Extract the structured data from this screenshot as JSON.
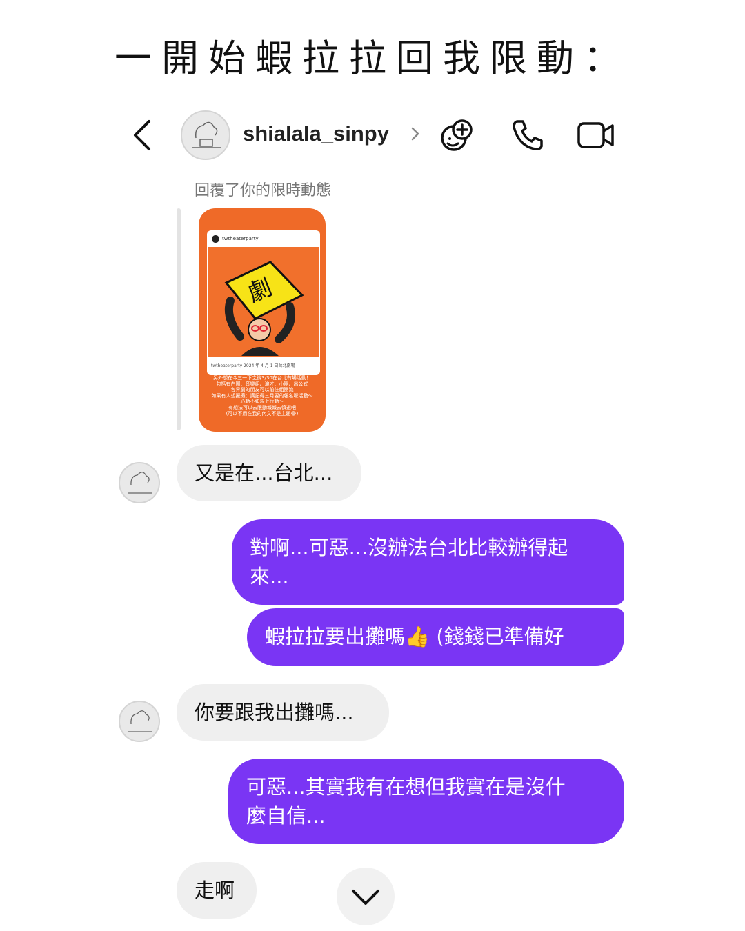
{
  "title": "一開始蝦拉拉回我限動：",
  "header": {
    "username": "shialala_sinpy",
    "icons": {
      "back": "chevron-left-icon",
      "chevron": "chevron-right-icon",
      "effects": "face-plus-icon",
      "call": "phone-icon",
      "video": "video-camera-icon"
    }
  },
  "reply_note": "回覆了你的限時動態",
  "story": {
    "account": "twtheaterparty",
    "caption": "twtheaterparty 2024 年 4 月 1 日台北劇場",
    "text": "另外想在今三一下之後3/30在台北有場活動！\n包括有白團、音樂組、演才、小團、出公式\n各界劇的朋友可以前往組團流\n如果有人想擺攤：講記得三月要的報名喔活動～\n心動不如馬上行動～\n有想法可以去限動報報去慎選吧\n(可以不用在我的內文不是主題😂)"
  },
  "messages": [
    {
      "side": "in",
      "text": "又是在...台北..."
    },
    {
      "side": "out",
      "text": "對啊...可惡...沒辦法台北比較辦得起\n來..."
    },
    {
      "side": "out",
      "text": "蝦拉拉要出攤嗎👍 (錢錢已準備好"
    },
    {
      "side": "in",
      "text": "你要跟我出攤嗎..."
    },
    {
      "side": "out",
      "text": "可惡...其實我有在想但我實在是沒什\n麼自信..."
    },
    {
      "side": "in",
      "text": "走啊"
    }
  ],
  "colors": {
    "outgoing": "#7a35f4",
    "incoming": "#efefef",
    "story": "#ef6a28"
  }
}
